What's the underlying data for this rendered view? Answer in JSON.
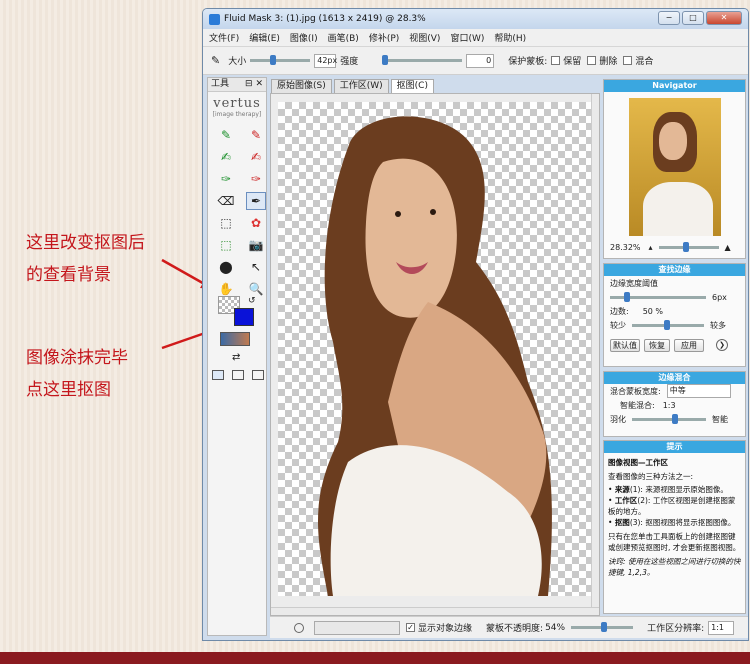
{
  "window": {
    "title": "Fluid Mask 3: (1).jpg (1613 x 2419) @ 28.3%",
    "min": "−",
    "max": "□",
    "close": "✕"
  },
  "menu": [
    "文件(F)",
    "编辑(E)",
    "图像(I)",
    "画笔(B)",
    "修补(P)",
    "视图(V)",
    "窗口(W)",
    "帮助(H)"
  ],
  "options": {
    "size_label": "大小",
    "size_value": "42px",
    "strength_label": "强度",
    "strength_value": "0",
    "protect_label": "保护蒙板:",
    "keep": "保留",
    "delete": "删除",
    "blend": "混合"
  },
  "toolpanel": {
    "title": "工具",
    "pin": "⊟ ✕",
    "brand": "vertus",
    "brand_sub": "[image therapy]"
  },
  "tabs": [
    "原始图像(S)",
    "工作区(W)",
    "抠图(C)"
  ],
  "annotations": {
    "line1": "这里改变抠图后",
    "line2": "的查看背景",
    "line3": "图像涂抹完毕",
    "line4": "点这里抠图"
  },
  "navigator": {
    "title": "Navigator",
    "zoom": "28.32%",
    "zoom_fraction": 0.45
  },
  "edge": {
    "title": "查找边缘",
    "width_label": "边缘宽度阈值",
    "width_value": "6px",
    "edge_label": "边数:",
    "edge_value": "50 %",
    "few": "较少",
    "many": "较多",
    "default_btn": "默认值",
    "restore_btn": "恢复",
    "apply_btn": "应用"
  },
  "blend": {
    "title": "边缘混合",
    "width_label": "混合蒙板宽度:",
    "width_value": "中等",
    "smart_label": "智能混合:",
    "smart_value": "1:3",
    "feather_label": "羽化",
    "smart": "智能"
  },
  "tips": {
    "title": "提示",
    "heading": "图像视图—工作区",
    "intro": "查看图像的三种方法之一:",
    "b1_head": "来源",
    "b1": "(1): 来源视图显示原始图像。",
    "b2_head": "工作区",
    "b2": "(2): 工作区视图是创建抠图蒙板的地方。",
    "b3_head": "抠图",
    "b3": "(3): 抠图视图将显示抠图图像。",
    "p2": "只有在您单击工具面板上的创建抠图键或创建预览抠图时, 才会更新抠图视图。",
    "hint": "诀窍: 使用在这些视图之间进行切换的快捷键, 1,2,3。"
  },
  "status": {
    "show_edges": "显示对象边缘",
    "opacity_label": "蒙板不透明度:",
    "opacity_value": "54%",
    "split_label": "工作区分辨率:",
    "split_value": "1:1",
    "opacity_fraction": 0.54
  }
}
